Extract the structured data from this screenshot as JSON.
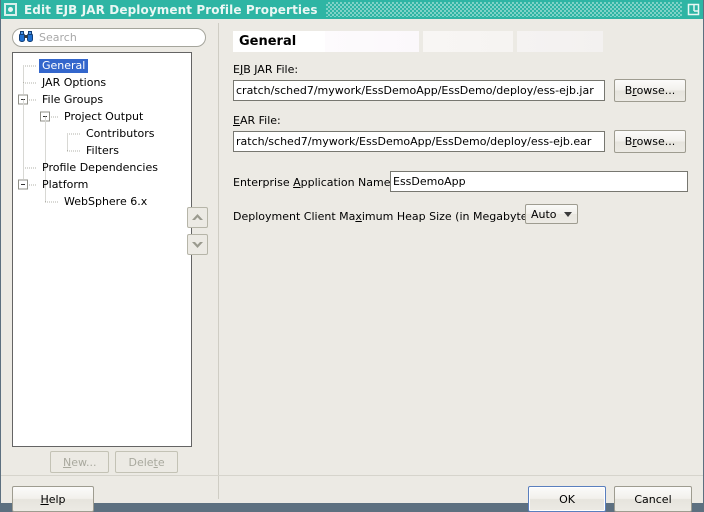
{
  "window": {
    "title": "Edit EJB JAR Deployment Profile Properties",
    "icon": "window-menu-icon",
    "restore_icon": "restore-window-icon",
    "accent_color": "#2eb5a4",
    "frame_color": "#5d7080"
  },
  "sidebar": {
    "search": {
      "placeholder": "Search",
      "value": "",
      "icon": "binoculars-icon"
    },
    "tree": [
      {
        "label": "General",
        "depth": 0,
        "selected": true,
        "expander": "none"
      },
      {
        "label": "JAR Options",
        "depth": 0,
        "selected": false,
        "expander": "none"
      },
      {
        "label": "File Groups",
        "depth": 0,
        "selected": false,
        "expander": "minus"
      },
      {
        "label": "Project Output",
        "depth": 1,
        "selected": false,
        "expander": "minus"
      },
      {
        "label": "Contributors",
        "depth": 2,
        "selected": false,
        "expander": "none"
      },
      {
        "label": "Filters",
        "depth": 2,
        "selected": false,
        "expander": "none"
      },
      {
        "label": "Profile Dependencies",
        "depth": 0,
        "selected": false,
        "expander": "none"
      },
      {
        "label": "Platform",
        "depth": 0,
        "selected": false,
        "expander": "minus"
      },
      {
        "label": "WebSphere 6.x",
        "depth": 1,
        "selected": false,
        "expander": "none"
      }
    ],
    "move_up_icon": "chevron-up-icon",
    "move_down_icon": "chevron-down-icon",
    "new_label": "New...",
    "new_mnemonic": "N",
    "delete_label": "Delete",
    "delete_mnemonic": "t",
    "new_enabled": false,
    "delete_enabled": false
  },
  "main": {
    "section_title": "General",
    "fields": {
      "ejb_jar": {
        "label_pre": "E",
        "label_mnemonic": "J",
        "label_post": "B JAR File:",
        "value": "cratch/sched7/mywork/EssDemoApp/EssDemo/deploy/ess-ejb.jar",
        "browse_label_pre": "B",
        "browse_mnemonic": "r",
        "browse_label_post": "owse..."
      },
      "ear": {
        "label_pre": "",
        "label_mnemonic": "E",
        "label_post": "AR File:",
        "value": "ratch/sched7/mywork/EssDemoApp/EssDemo/deploy/ess-ejb.ear",
        "browse_label_pre": "B",
        "browse_mnemonic": "r",
        "browse_label_post": "owse..."
      },
      "app_name": {
        "label_pre": "Enterprise ",
        "label_mnemonic": "A",
        "label_post": "pplication Name:",
        "value": "EssDemoApp"
      },
      "heap_size": {
        "label_pre": "Deployment Client Ma",
        "label_mnemonic": "x",
        "label_post": "imum Heap Size (in Megabytes):",
        "value": "Auto",
        "options": [
          "Auto"
        ],
        "caret_icon": "chevron-down-icon"
      }
    }
  },
  "footer": {
    "help_label_pre": "",
    "help_mnemonic": "H",
    "help_label_post": "elp",
    "ok_label": "OK",
    "cancel_label": "Cancel"
  }
}
